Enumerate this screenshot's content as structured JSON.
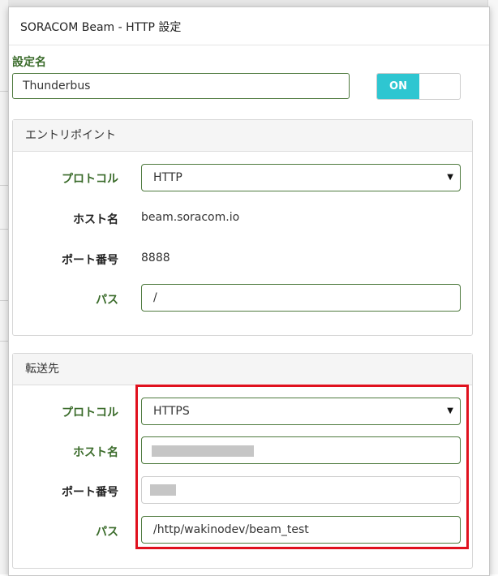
{
  "dialog": {
    "title": "SORACOM Beam - HTTP 設定",
    "config_name_label": "設定名",
    "config_name_value": "Thunderbus",
    "toggle_label": "ON"
  },
  "entrypoint": {
    "heading": "エントリポイント",
    "protocol_label": "プロトコル",
    "protocol_value": "HTTP",
    "host_label": "ホスト名",
    "host_value": "beam.soracom.io",
    "port_label": "ポート番号",
    "port_value": "8888",
    "path_label": "パス",
    "path_value": "/"
  },
  "destination": {
    "heading": "転送先",
    "protocol_label": "プロトコル",
    "protocol_value": "HTTPS",
    "host_label": "ホスト名",
    "port_label": "ポート番号",
    "path_label": "パス",
    "path_value": "/http/wakinodev/beam_test"
  },
  "colors": {
    "label_green": "#3a6b2a",
    "toggle_on": "#2ec6d1",
    "highlight_red": "#e0111e"
  },
  "icons": {
    "select_arrow": "caret-down-icon"
  }
}
